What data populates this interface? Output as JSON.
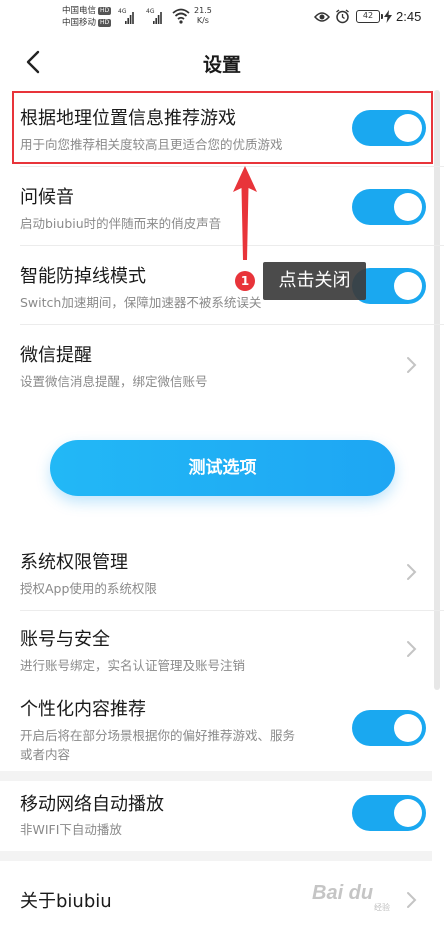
{
  "status_bar": {
    "carrier_1": "中国电信",
    "carrier_2": "中国移动",
    "hd": "HD",
    "network_type": "4G",
    "speed_value": "21.5",
    "speed_unit": "K/s",
    "battery": "42",
    "time": "2:45"
  },
  "header": {
    "title": "设置"
  },
  "settings": {
    "location_recommend": {
      "title": "根据地理位置信息推荐游戏",
      "desc": "用于向您推荐相关度较高且更适合您的优质游戏",
      "enabled": true
    },
    "greeting_sound": {
      "title": "问候音",
      "desc": "启动biubiu时的伴随而来的俏皮声音",
      "enabled": true
    },
    "anti_disconnect": {
      "title": "智能防掉线模式",
      "desc": "Switch加速期间，保障加速器不被系统误关",
      "enabled": true
    },
    "wechat_reminder": {
      "title": "微信提醒",
      "desc": "设置微信消息提醒，绑定微信账号"
    },
    "test_button_label": "测试选项",
    "permissions": {
      "title": "系统权限管理",
      "desc": "授权App使用的系统权限"
    },
    "account_security": {
      "title": "账号与安全",
      "desc": "进行账号绑定，实名认证管理及账号注销"
    },
    "personalized": {
      "title": "个性化内容推荐",
      "desc_line1": "开启后将在部分场景根据你的偏好推荐游戏、服务",
      "desc_line2": "或者内容",
      "enabled": true
    },
    "mobile_autoplay": {
      "title": "移动网络自动播放",
      "desc": "非WIFI下自动播放",
      "enabled": true
    },
    "about": {
      "title": "关于biubiu"
    }
  },
  "annotation": {
    "step_number": "1",
    "tooltip": "点击关闭",
    "highlight_color": "#e8343a"
  },
  "watermark": {
    "text": "Bai du",
    "sub": "经验"
  },
  "colors": {
    "accent": "#1aa8f0",
    "text_primary": "#1a1a1a",
    "text_secondary": "#8a8a8a"
  }
}
